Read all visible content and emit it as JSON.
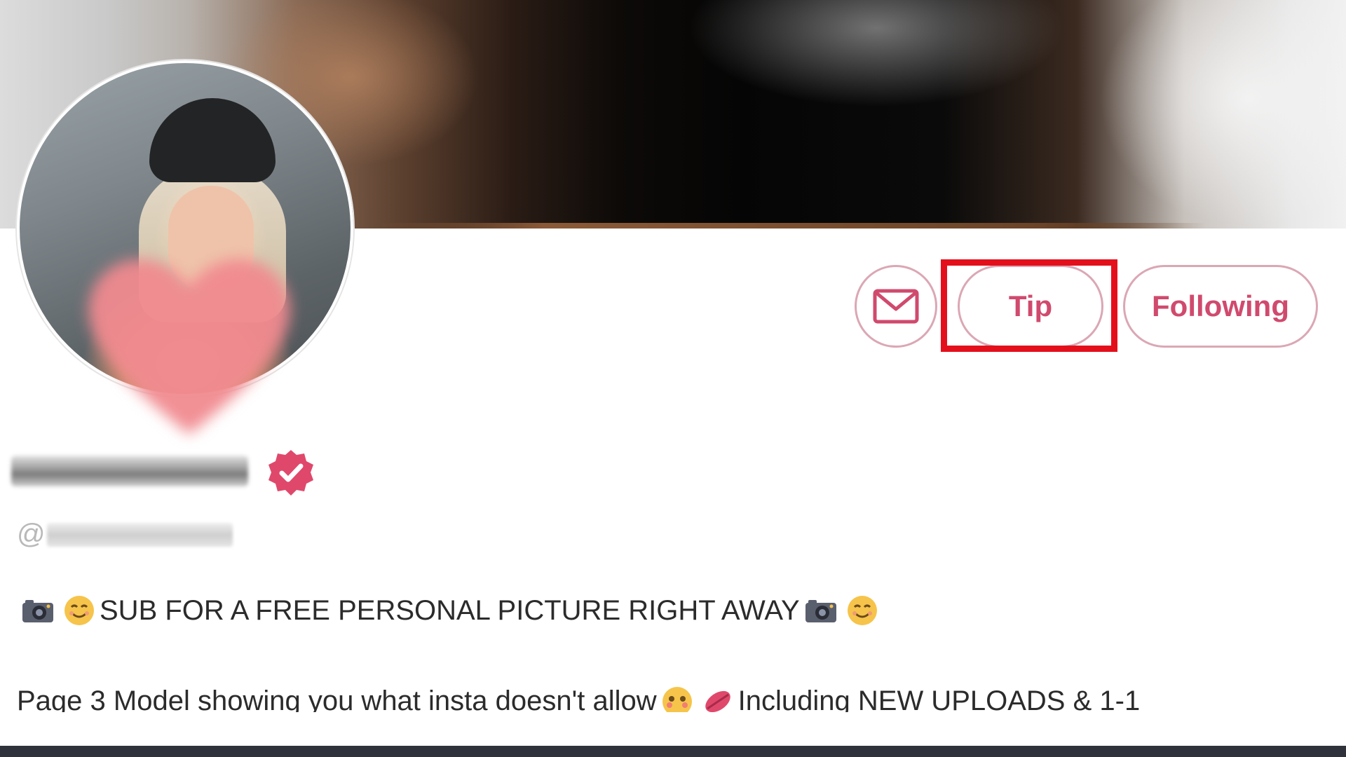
{
  "actions": {
    "message_icon": "envelope-icon",
    "tip_label": "Tip",
    "following_label": "Following",
    "accent_color": "#d04a6d",
    "border_color": "#dba7b4",
    "highlight_color": "#e3101c"
  },
  "profile": {
    "verified_icon": "verified-badge-icon",
    "handle_prefix": "@"
  },
  "bio": {
    "line1_text": "SUB FOR A FREE PERSONAL PICTURE RIGHT AWAY",
    "line2_text_a": "Page 3 Model showing you what insta doesn't allow",
    "line2_text_b": "Including NEW UPLOADS & 1-1"
  }
}
